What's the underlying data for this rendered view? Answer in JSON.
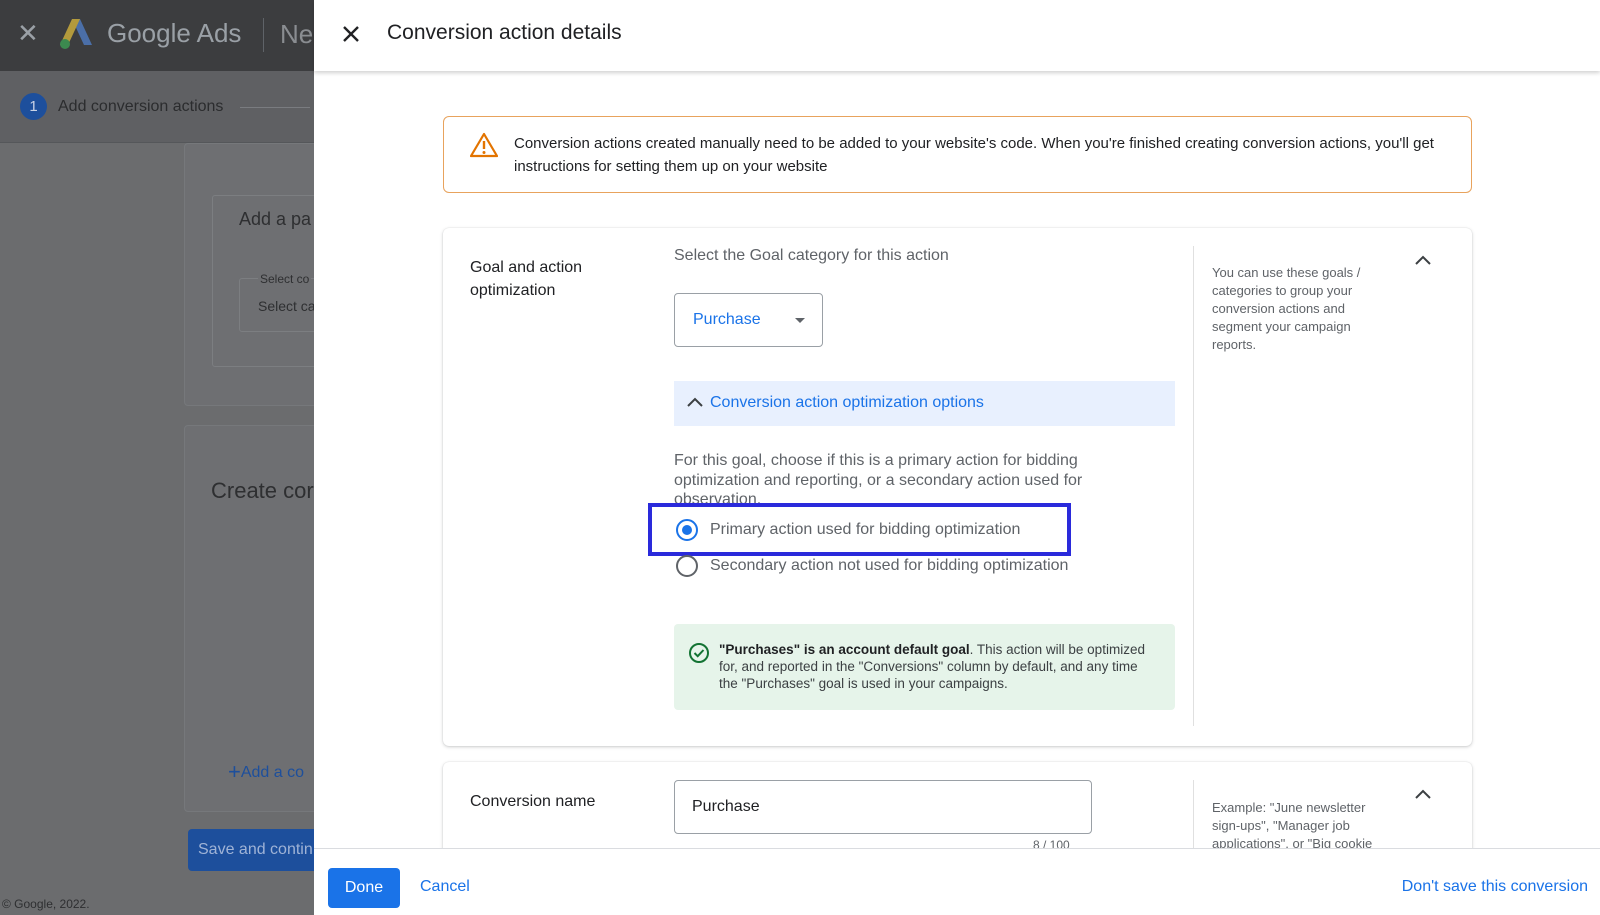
{
  "background_app": {
    "brand": "Google Ads",
    "next_truncated": "Ne",
    "step": {
      "number": "1",
      "label": "Add conversion actions"
    },
    "card1_title": "Add a pa",
    "select_label": "Select co",
    "select_placeholder": "Select ca",
    "card2_title": "Create cor",
    "add_link": "Add a co",
    "save_button": "Save and contin",
    "footer": "© Google, 2022."
  },
  "dialog": {
    "title": "Conversion action details",
    "alert": "Conversion actions created manually need to be added to your website's code. When you're finished creating conversion actions, you'll get instructions for setting them up on your website",
    "goal_section": {
      "label": "Goal and action optimization",
      "prompt": "Select the Goal category for this action",
      "category_value": "Purchase",
      "options_toggle": "Conversion action optimization options",
      "options_description": "For this goal, choose if this is a primary action for bidding optimization and reporting, or a secondary action used for observation.",
      "radio_primary": "Primary action used for bidding optimization",
      "radio_secondary": "Secondary action not used for bidding optimization",
      "selected_option": "primary",
      "info_bold": "\"Purchases\" is an account default goal",
      "info_rest": ". This action will be optimized for, and reported in the \"Conversions\" column by default, and any time the \"Purchases\" goal is used in your campaigns.",
      "help_text": "You can use these goals / categories to group your conversion actions and segment your campaign reports."
    },
    "name_section": {
      "label": "Conversion name",
      "value": "Purchase",
      "char_count": "8 / 100",
      "help_text": "Example: \"June newsletter sign-ups\", \"Manager job applications\", or \"Big cookie"
    },
    "footer": {
      "done": "Done",
      "cancel": "Cancel",
      "dont_save": "Don't save this conversion"
    }
  },
  "colors": {
    "accent": "#1a73e8",
    "alert_border": "#e8a35d",
    "highlight": "#2a2adb",
    "success_bg": "#e6f4ea"
  }
}
